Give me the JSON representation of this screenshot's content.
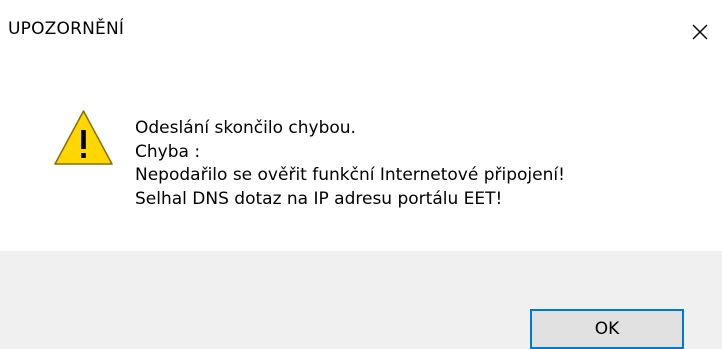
{
  "dialog": {
    "title": "UPOZORNĚNÍ",
    "close_icon": "close-icon",
    "icon": "warning-icon",
    "colors": {
      "warning_fill": "#ffd700",
      "warning_stroke": "#8a6d00",
      "footer_bg": "#f0f0f0",
      "button_bg": "#e1e1e1",
      "button_border": "#0078d7"
    },
    "message_lines": [
      "Odeslání skončilo chybou.",
      "Chyba :",
      "Nepodařilo se ověřit funkční Internetové připojení!",
      "Selhal DNS dotaz na IP adresu portálu EET!"
    ],
    "ok_label": "OK"
  }
}
